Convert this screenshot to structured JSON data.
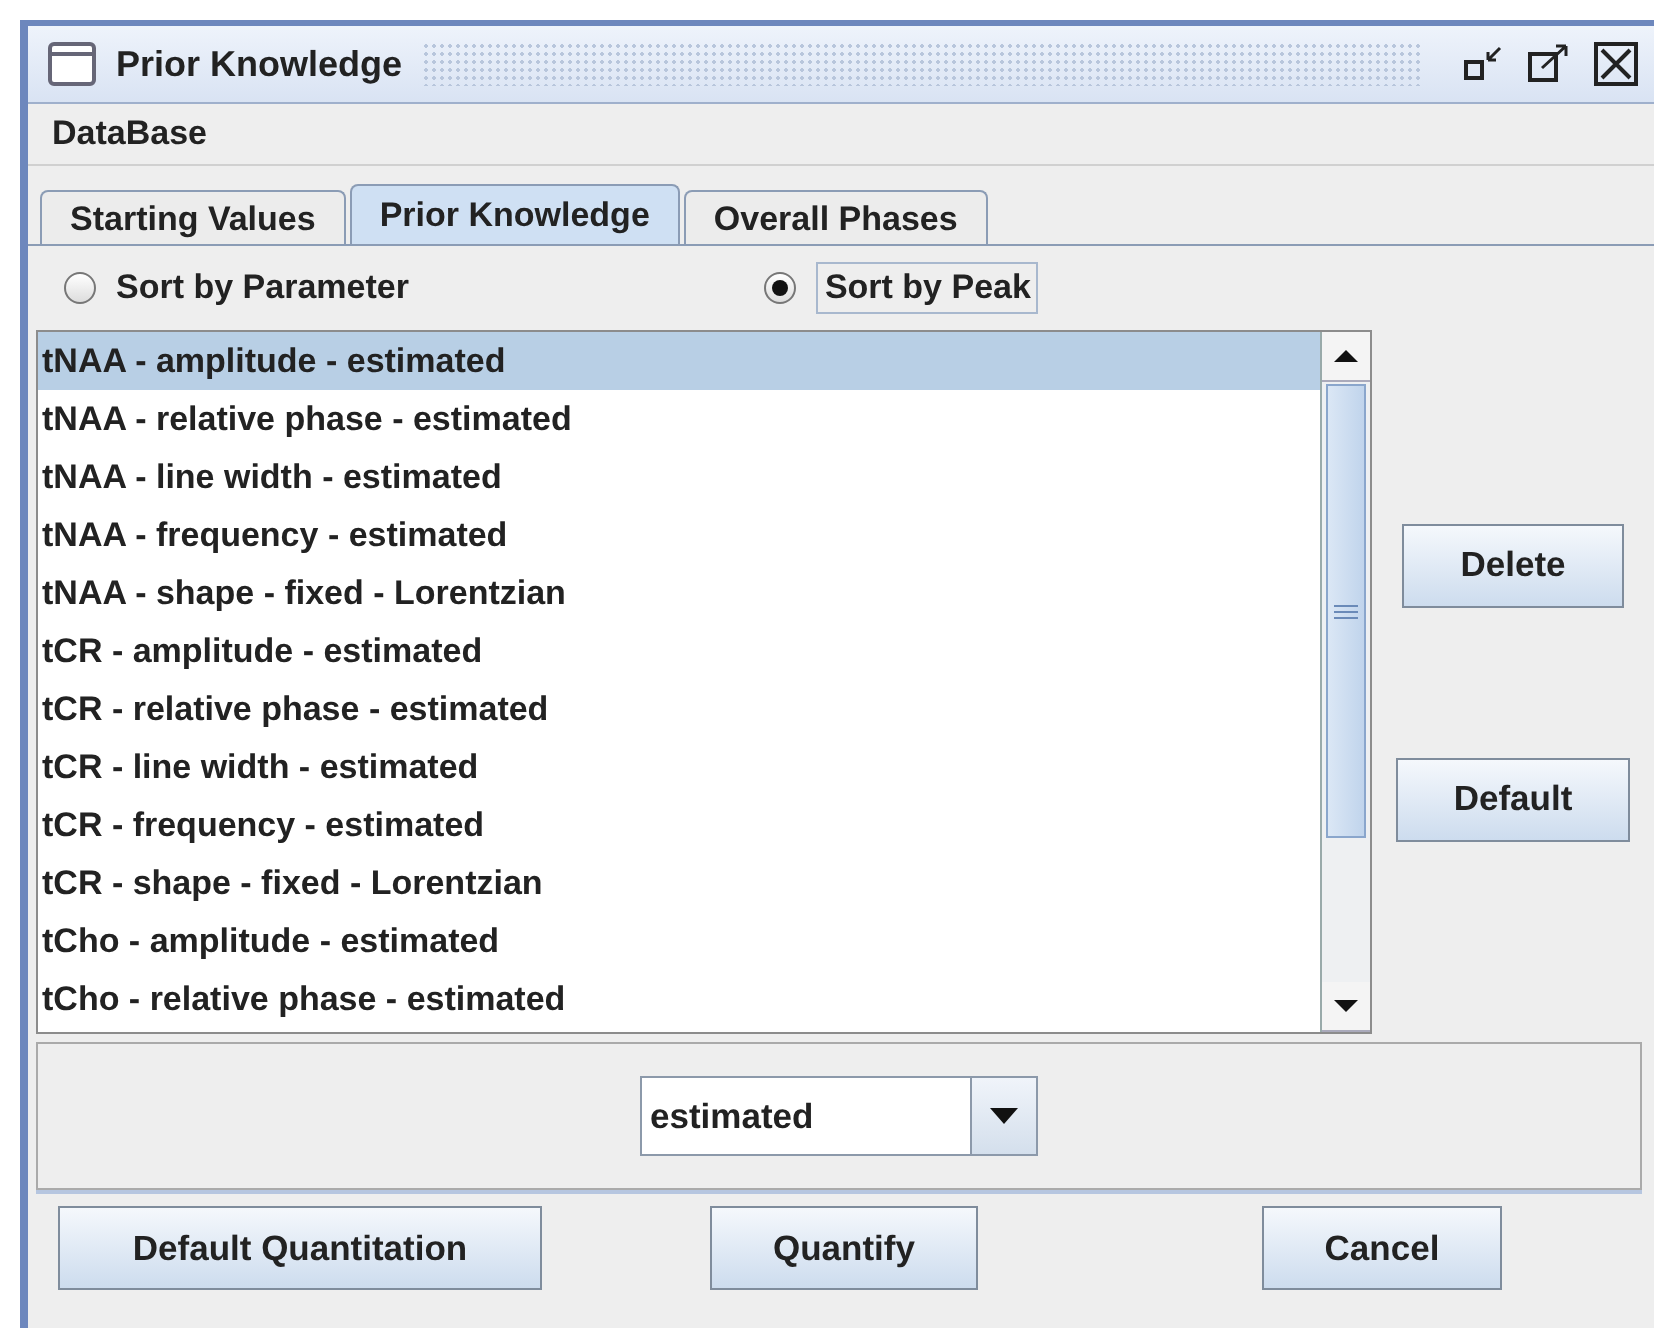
{
  "window": {
    "title": "Prior Knowledge"
  },
  "menu": [
    "DataBase"
  ],
  "tabs": [
    {
      "label": "Starting Values",
      "selected": false
    },
    {
      "label": "Prior Knowledge",
      "selected": true
    },
    {
      "label": "Overall Phases",
      "selected": false
    }
  ],
  "sort_options": [
    {
      "label": "Sort by Parameter",
      "selected": false
    },
    {
      "label": "Sort by Peak",
      "selected": true
    }
  ],
  "list": [
    {
      "text": "tNAA - amplitude - estimated",
      "selected": true
    },
    {
      "text": "tNAA - relative phase - estimated",
      "selected": false
    },
    {
      "text": "tNAA - line width - estimated",
      "selected": false
    },
    {
      "text": "tNAA - frequency - estimated",
      "selected": false
    },
    {
      "text": "tNAA - shape - fixed - Lorentzian",
      "selected": false
    },
    {
      "text": "tCR - amplitude - estimated",
      "selected": false
    },
    {
      "text": "tCR - relative phase - estimated",
      "selected": false
    },
    {
      "text": "tCR - line width - estimated",
      "selected": false
    },
    {
      "text": "tCR - frequency - estimated",
      "selected": false
    },
    {
      "text": "tCR - shape - fixed - Lorentzian",
      "selected": false
    },
    {
      "text": "tCho - amplitude - estimated",
      "selected": false
    },
    {
      "text": "tCho - relative phase - estimated",
      "selected": false
    }
  ],
  "side_buttons": [
    "Delete",
    "Default"
  ],
  "dropdown": {
    "value": "estimated"
  },
  "buttons": [
    "Default Quantitation",
    "Quantify",
    "Cancel"
  ]
}
